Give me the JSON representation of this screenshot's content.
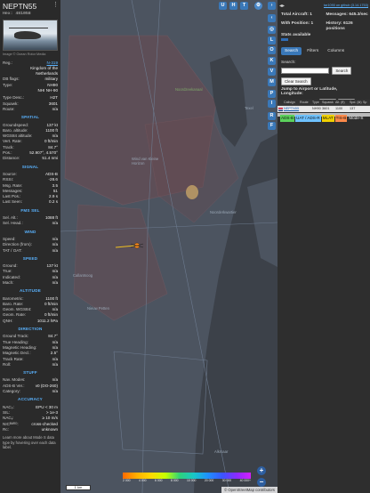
{
  "aircraft": {
    "callsign": "NEPTN55",
    "hex_label": "Hex: 481058",
    "photo_caption": "Image © Ocean Rotor Media",
    "registration": "N-319",
    "country": "Kingdom of the Netherlands",
    "db_flags": "military",
    "type": "NH90",
    "type_full": "NHI NH-90",
    "type_desc": "H2T",
    "squawk": "3601",
    "route": "n/a"
  },
  "labels": {
    "reg": "Reg.:",
    "db_flags": "DB flags:",
    "type": "Type:",
    "type_desc": "Type Desc.:",
    "squawk": "Squawk:",
    "route": "Route:"
  },
  "sections": [
    {
      "title": "SPATIAL",
      "rows": [
        {
          "k": "Groundspeed:",
          "v": "137 kt"
        },
        {
          "k": "Baro. altitude:",
          "v": "1100 ft"
        },
        {
          "k": "WGS84 altitude:",
          "v": "n/a"
        },
        {
          "k": "Vert. Rate:",
          "v": "0 ft/min"
        },
        {
          "k": "Track:",
          "v": "84.7°"
        },
        {
          "k": "Pos.:",
          "v": "52.907°, 4.570°"
        },
        {
          "k": "Distance:",
          "v": "51.4 nmi"
        }
      ]
    },
    {
      "title": "SIGNAL",
      "rows": [
        {
          "k": "Source:",
          "v": "ADS-B"
        },
        {
          "k": "RSSI:",
          "v": "-28.6"
        },
        {
          "k": "Msg. Rate:",
          "v": "3.5"
        },
        {
          "k": "Messages:",
          "v": "51"
        },
        {
          "k": "Last Pos.:",
          "v": "2.9 s"
        },
        {
          "k": "Last Seen:",
          "v": "0.2 s"
        }
      ]
    },
    {
      "title": "FMS SEL",
      "rows": [
        {
          "k": "Sel. Alt.:",
          "v": "1088 ft"
        },
        {
          "k": "Sel. Head.:",
          "v": "n/a"
        }
      ]
    },
    {
      "title": "WIND",
      "rows": [
        {
          "k": "Speed:",
          "v": "n/a"
        },
        {
          "k": "Direction (from):",
          "v": "n/a"
        },
        {
          "k": "TAT / OAT:",
          "v": "n/a"
        }
      ]
    },
    {
      "title": "SPEED",
      "rows": [
        {
          "k": "Ground:",
          "v": "137 kt"
        },
        {
          "k": "True:",
          "v": "n/a"
        },
        {
          "k": "Indicated:",
          "v": "n/a"
        },
        {
          "k": "Mach:",
          "v": "n/a"
        }
      ]
    },
    {
      "title": "ALTITUDE",
      "rows": [
        {
          "k": "Barometric:",
          "v": "1100 ft"
        },
        {
          "k": "Baro. Rate:",
          "v": "0 ft/min"
        },
        {
          "k": "Geom. WGS84:",
          "v": "n/a"
        },
        {
          "k": "Geom. Rate:",
          "v": "0 ft/min"
        },
        {
          "k": "QNH:",
          "v": "1011.2 hPa"
        }
      ]
    },
    {
      "title": "DIRECTION",
      "rows": [
        {
          "k": "Ground Track:",
          "v": "84.7°"
        },
        {
          "k": "True Heading:",
          "v": "n/a"
        },
        {
          "k": "Magnetic Heading:",
          "v": "n/a"
        },
        {
          "k": "Magnetic Decl.:",
          "v": "2.5°"
        },
        {
          "k": "Track Rate:",
          "v": "n/a"
        },
        {
          "k": "Roll:",
          "v": "n/a"
        }
      ]
    },
    {
      "title": "STUFF",
      "rows": [
        {
          "k": "Nav. Modes:",
          "v": "n/a"
        },
        {
          "k": "ADS-B Ver.:",
          "v": "v0 (DO-260)"
        },
        {
          "k": "Category:",
          "v": "n/a"
        }
      ]
    },
    {
      "title": "ACCURACY",
      "rows": [
        {
          "k": "NACₚ:",
          "v": "EPU < 30 m"
        },
        {
          "k": "SIL:",
          "v": "> 1e-3"
        },
        {
          "k": "NACᵥ:",
          "v": "≥ 10 m/s"
        },
        {
          "k": "NICᴮᴬᴿᴼ:",
          "v": "cross-checked"
        },
        {
          "k": "Rᴄ:",
          "v": "unknown"
        }
      ]
    }
  ],
  "help_note": "Learn more about Mode S data type by hovering over each data label.",
  "map": {
    "top_buttons": [
      "U",
      "H",
      "T"
    ],
    "side_buttons": [
      "L",
      "O",
      "K",
      "M",
      "P",
      "I",
      "R",
      "F"
    ],
    "place_labels": [
      "Noordzeekanaal",
      "Texel",
      "Wind van Kleine Horizon",
      "Noorderkwartier",
      "Nieuw Petten",
      "Callantsoog",
      "Alkmaar"
    ],
    "zoom_in": "+",
    "zoom_out": "−",
    "scale_label": "1 km",
    "altitude_legend": [
      "2 000",
      "4 000",
      "6 000",
      "8 000",
      "10 000",
      "20 000",
      "30 000",
      "40 000+"
    ],
    "attribution": "© OpenStreetMap contributors"
  },
  "stats": {
    "total_aircraft": "Total Aircraft: 1",
    "messages": "Messages: 645.3/sec",
    "with_position": "With Position: 1",
    "history": "History: 6126 positions",
    "stats_available": "Stats available",
    "source_link": "tar1090 on github (3.14.1753)"
  },
  "tabs": [
    "Search",
    "Filters",
    "Columns"
  ],
  "search": {
    "label": "Search:",
    "button": "Search",
    "clear_button": "Clear Search",
    "jump_label": "Jump to Airport or Latitude, Longitude:",
    "jump_button": "Jump",
    "clear_short": "Clear"
  },
  "table": {
    "headers": [
      "",
      "Callsign",
      "Route",
      "Type",
      "Squawk",
      "Alt. (ft)",
      "Spd. (kt)",
      "Sp"
    ],
    "rows": [
      {
        "flag": "NL",
        "callsign": "NEPTN55",
        "route": "",
        "type": "NH90",
        "squawk": "3601",
        "altitude": "1100",
        "speed": "137"
      }
    ]
  },
  "legend_filters": [
    {
      "label": "ADS-B",
      "color": "#5bd15b"
    },
    {
      "label": "UAT / ADS-R",
      "color": "#6fc2ff"
    },
    {
      "label": "MLAT",
      "color": "#f0d000"
    },
    {
      "label": "TIS-B",
      "color": "#ff8a4a"
    },
    {
      "label": "Mode-S",
      "color": ""
    }
  ],
  "colors": {
    "accent": "#3a78b8",
    "section_heading": "#5ab3ff",
    "aircraft_icon": "#ff8c1a"
  }
}
